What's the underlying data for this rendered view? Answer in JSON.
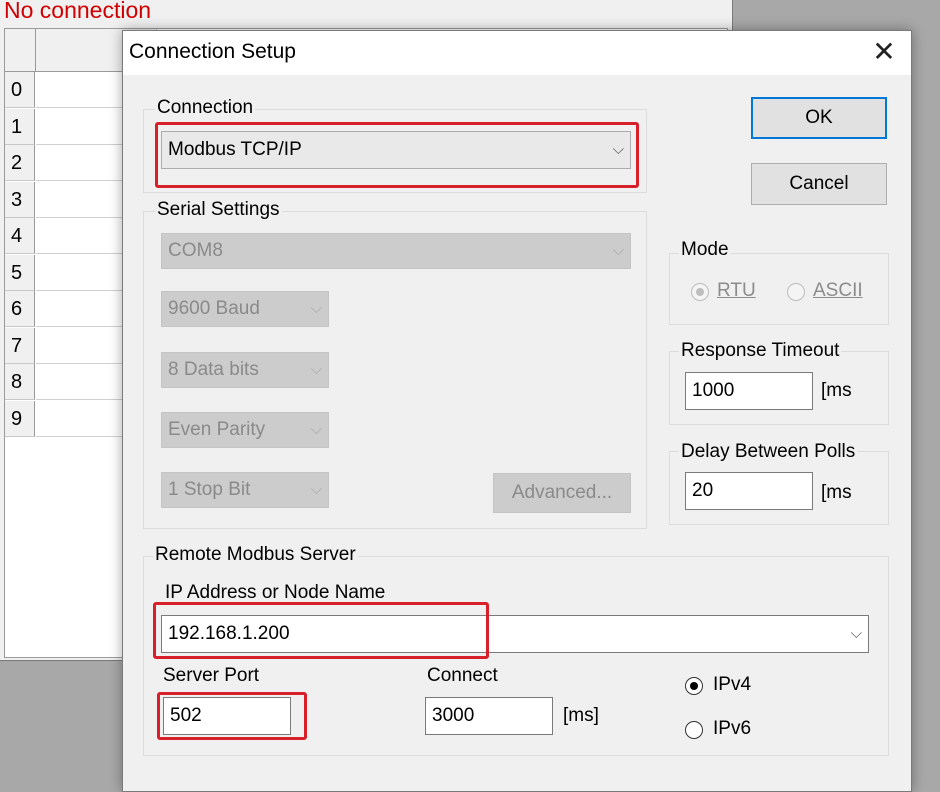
{
  "background_window": {
    "status_text": "No connection",
    "row_numbers": [
      "0",
      "1",
      "2",
      "3",
      "4",
      "5",
      "6",
      "7",
      "8",
      "9"
    ]
  },
  "dialog": {
    "title": "Connection Setup",
    "close_glyph": "✕",
    "connection": {
      "group_label": "Connection",
      "selected": "Modbus TCP/IP"
    },
    "serial_settings": {
      "group_label": "Serial Settings",
      "port": "COM8",
      "baud": "9600 Baud",
      "data_bits": "8 Data bits",
      "parity": "Even Parity",
      "stop_bits": "1 Stop Bit",
      "advanced_label": "Advanced..."
    },
    "buttons": {
      "ok": "OK",
      "cancel": "Cancel"
    },
    "mode": {
      "group_label": "Mode",
      "rtu_label": "RTU",
      "ascii_label": "ASCII",
      "selected": "RTU"
    },
    "response_timeout": {
      "label": "Response Timeout",
      "value": "1000",
      "unit": "[ms"
    },
    "delay_between_polls": {
      "label": "Delay Between Polls",
      "value": "20",
      "unit": "[ms"
    },
    "remote_server": {
      "group_label": "Remote Modbus Server",
      "ip_label": "IP Address or Node Name",
      "ip_value": "192.168.1.200",
      "server_port_label": "Server Port",
      "server_port_value": "502",
      "connect_label": "Connect",
      "connect_value": "3000",
      "connect_unit": "[ms]",
      "ipv4_label": "IPv4",
      "ipv6_label": "IPv6",
      "ip_version_selected": "IPv4"
    },
    "chevron_glyph": "⌵"
  },
  "colors": {
    "highlight": "#d8202a",
    "status_text": "#d00000",
    "default_button_border": "#0078d7"
  }
}
